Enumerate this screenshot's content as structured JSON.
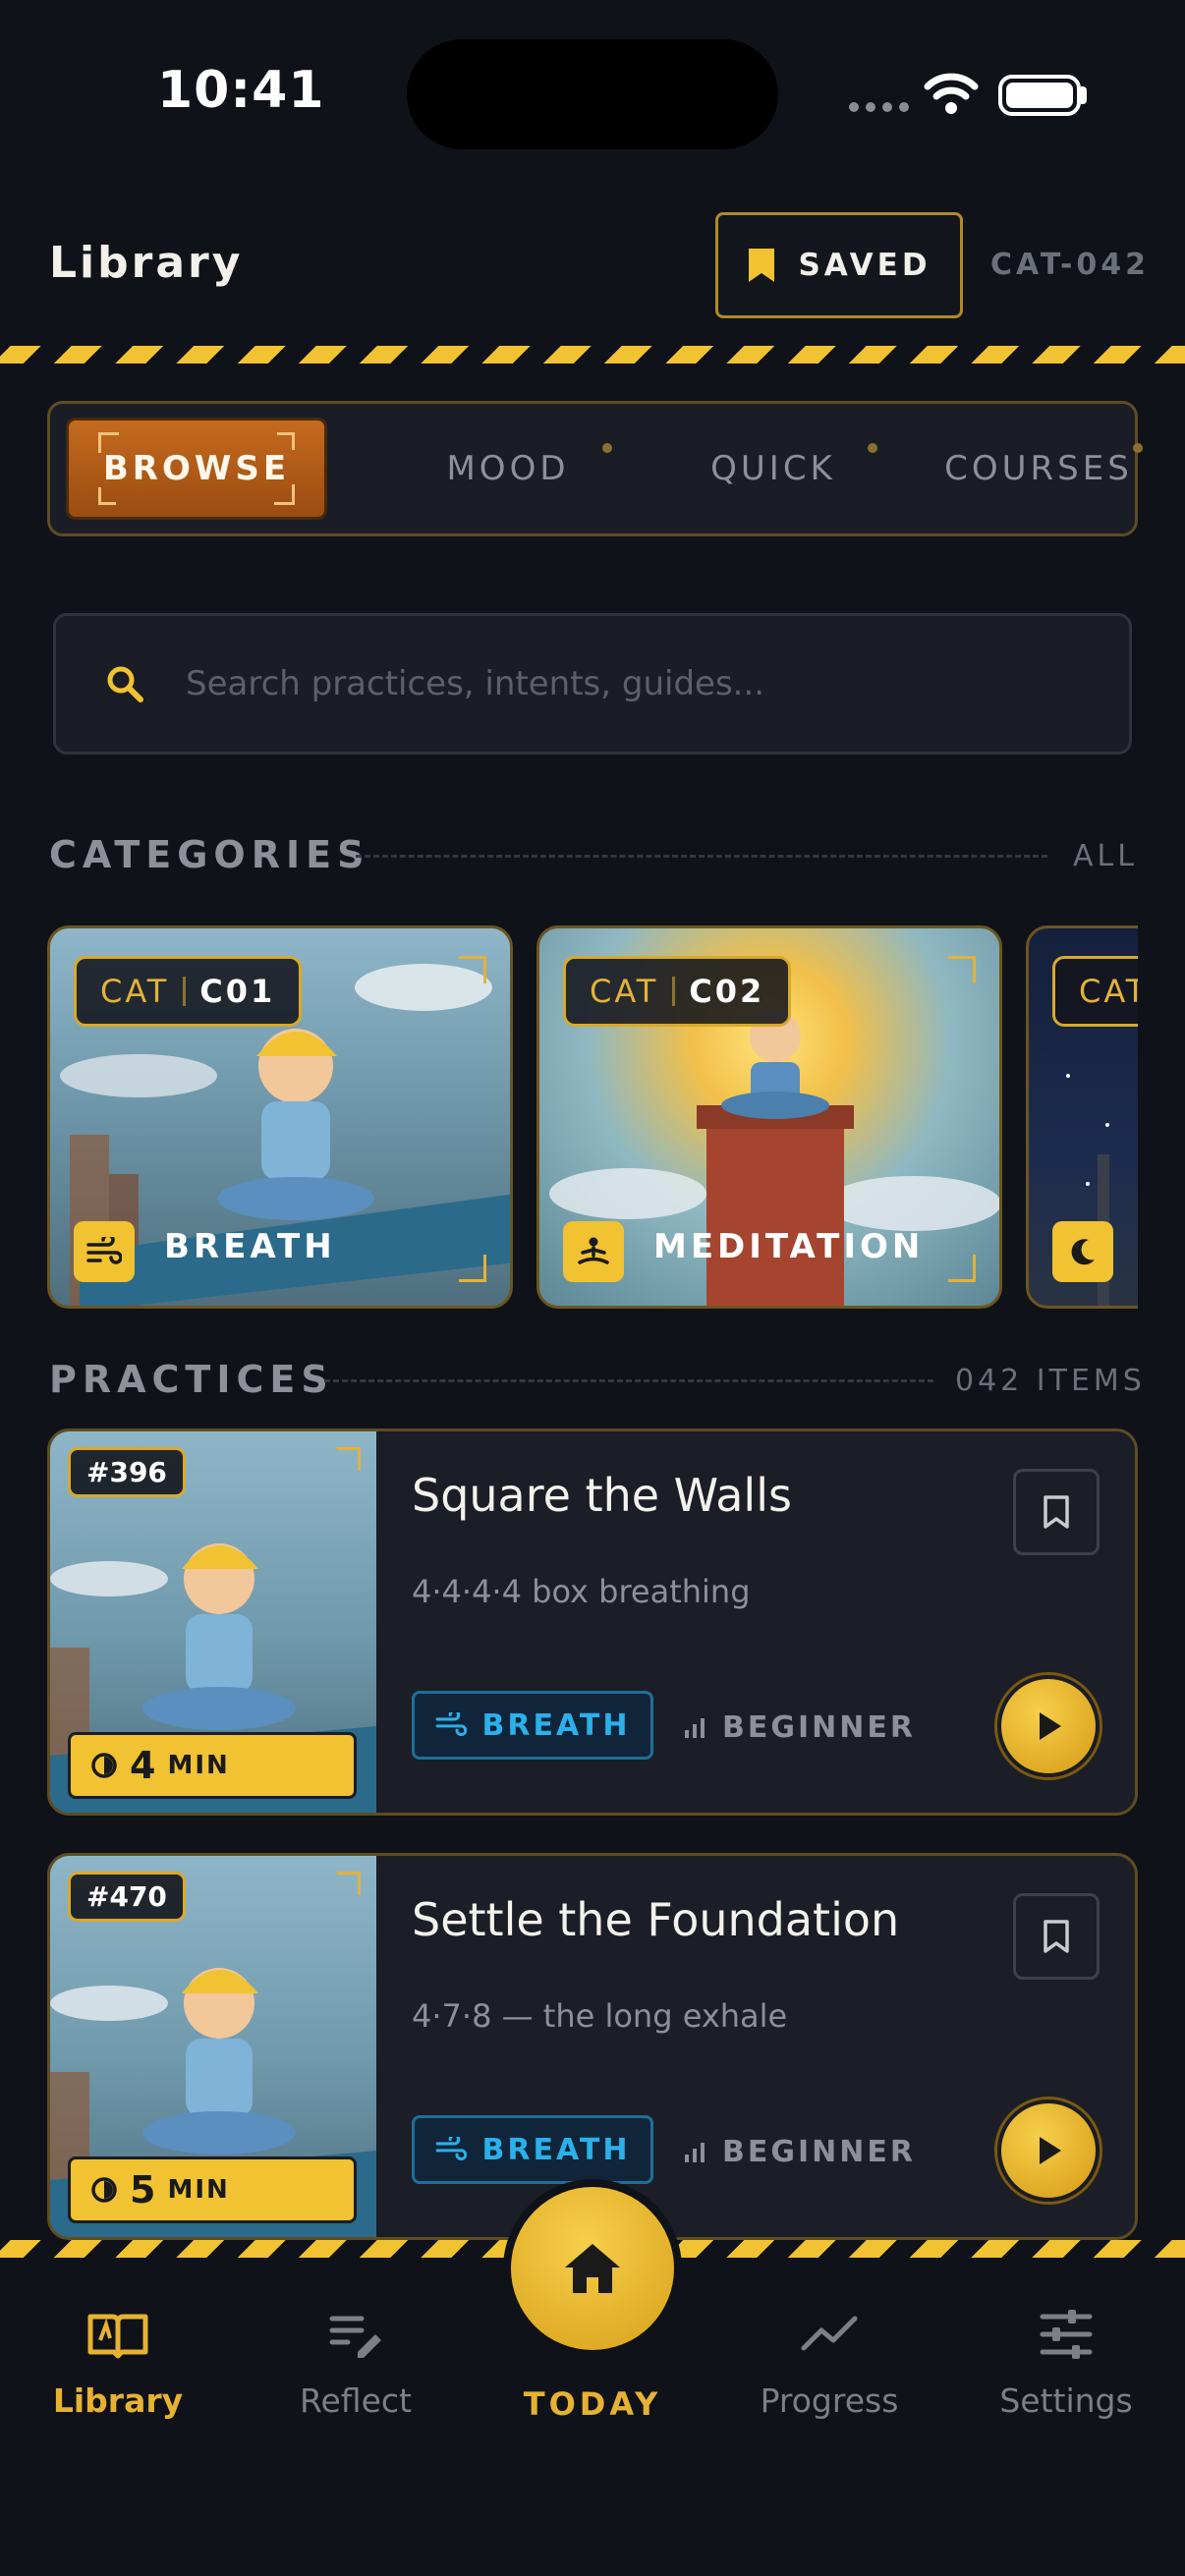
{
  "status_bar": {
    "time": "10:41"
  },
  "header": {
    "title": "Library",
    "saved_label": "SAVED",
    "code": "CAT-042"
  },
  "tabs": [
    {
      "label": "BROWSE",
      "active": true
    },
    {
      "label": "MOOD",
      "active": false
    },
    {
      "label": "QUICK",
      "active": false
    },
    {
      "label": "COURSES",
      "active": false
    }
  ],
  "search": {
    "placeholder": "Search practices, intents, guides..."
  },
  "categories_section": {
    "title": "CATEGORIES",
    "action": "ALL"
  },
  "categories": [
    {
      "prefix": "CAT",
      "code": "C01",
      "label": "BREATH",
      "icon": "wind-icon"
    },
    {
      "prefix": "CAT",
      "code": "C02",
      "label": "MEDITATION",
      "icon": "meditation-icon"
    },
    {
      "prefix": "CAT",
      "code": "",
      "label": "",
      "icon": "moon-icon"
    }
  ],
  "practices_section": {
    "title": "PRACTICES",
    "count": "042 ITEMS"
  },
  "practices": [
    {
      "number": "#396",
      "title": "Square the Walls",
      "subtitle": "4·4·4·4 box breathing",
      "duration": "4",
      "duration_unit": "MIN",
      "tag": "BREATH",
      "level": "BEGINNER"
    },
    {
      "number": "#470",
      "title": "Settle the Foundation",
      "subtitle": "4·7·8 — the long exhale",
      "duration": "5",
      "duration_unit": "MIN",
      "tag": "BREATH",
      "level": "BEGINNER"
    }
  ],
  "nav": {
    "library": "Library",
    "reflect": "Reflect",
    "today": "TODAY",
    "progress": "Progress",
    "settings": "Settings"
  },
  "colors": {
    "accent": "#f1c232",
    "orange": "#c56a1e",
    "breath_blue": "#2bb0ea",
    "bg": "#0f1218"
  }
}
